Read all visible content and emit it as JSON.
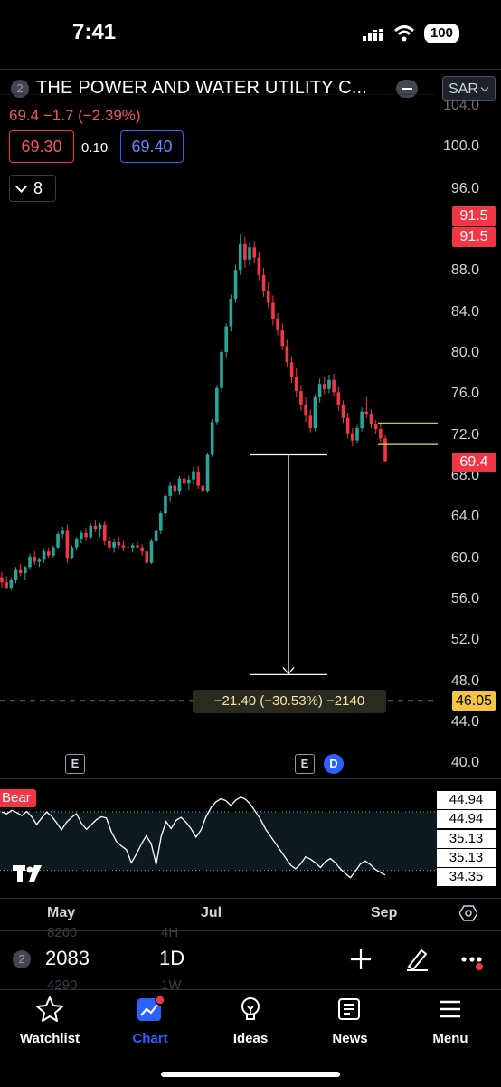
{
  "status": {
    "time": "7:41",
    "battery": "100"
  },
  "header": {
    "symbol_badge": "2",
    "title": "THE POWER AND WATER UTILITY C...",
    "currency": "SAR",
    "price_line": "69.4  −1.7 (−2.39%)",
    "bid": "69.30",
    "spread": "0.10",
    "ask": "69.40",
    "indicators_count": "8"
  },
  "price_axis": {
    "ticks": [
      "100.0",
      "96.0",
      "88.0",
      "84.0",
      "80.0",
      "76.0",
      "72.0",
      "68.0",
      "64.0",
      "60.0",
      "56.0",
      "52.0",
      "48.0",
      "44.0",
      "40.0"
    ],
    "partial_top": "104.0"
  },
  "price_tags": {
    "high_a": "91.5",
    "high_b": "91.5",
    "last": "69.4",
    "target": "46.05"
  },
  "measure_label": "−21.40 (−30.53%) −2140",
  "events": {
    "earnings_1": "E",
    "earnings_2": "E",
    "dividend": "D"
  },
  "oscillator": {
    "label": "Bear",
    "tags": [
      "44.94",
      "44.94",
      "35.13",
      "35.13",
      "34.35"
    ]
  },
  "time_axis": [
    "May",
    "Jul",
    "Sep"
  ],
  "bottom_toolbar": {
    "symbol_badge": "2",
    "symbol": "2083",
    "interval": "1D",
    "ghost_above_symbol": "8260",
    "ghost_below_symbol": "4290",
    "ghost_above_interval": "4H",
    "ghost_below_interval": "1W"
  },
  "tabs": [
    {
      "label": "Watchlist",
      "icon": "star-icon"
    },
    {
      "label": "Chart",
      "icon": "chart-icon",
      "active": true
    },
    {
      "label": "Ideas",
      "icon": "lightbulb-icon"
    },
    {
      "label": "News",
      "icon": "news-icon"
    },
    {
      "label": "Menu",
      "icon": "menu-icon"
    }
  ],
  "colors": {
    "up": "#26a69a",
    "down": "#f23645",
    "accent": "#2962ff",
    "target": "#f5c542"
  },
  "chart_data": {
    "type": "candlestick",
    "x_labels": [
      "May",
      "Jul",
      "Sep"
    ],
    "ylim": [
      40,
      104
    ],
    "candles": [
      [
        58.0,
        58.6,
        57.0,
        57.6
      ],
      [
        57.6,
        58.2,
        56.9,
        57.0
      ],
      [
        57.0,
        58.0,
        56.8,
        57.8
      ],
      [
        57.8,
        59.0,
        57.5,
        58.8
      ],
      [
        58.8,
        59.4,
        58.2,
        58.5
      ],
      [
        58.5,
        59.2,
        57.8,
        59.0
      ],
      [
        59.0,
        60.4,
        58.8,
        60.1
      ],
      [
        60.1,
        60.6,
        59.3,
        59.6
      ],
      [
        59.6,
        60.0,
        59.0,
        59.8
      ],
      [
        59.8,
        60.8,
        59.5,
        60.6
      ],
      [
        60.6,
        61.0,
        59.9,
        60.2
      ],
      [
        60.2,
        61.2,
        60.0,
        61.0
      ],
      [
        61.0,
        62.5,
        60.8,
        62.3
      ],
      [
        62.3,
        63.0,
        61.9,
        62.6
      ],
      [
        62.6,
        63.2,
        59.5,
        60.0
      ],
      [
        60.0,
        61.2,
        59.8,
        61.0
      ],
      [
        61.0,
        62.0,
        60.7,
        61.8
      ],
      [
        61.8,
        62.6,
        61.4,
        62.4
      ],
      [
        62.4,
        62.9,
        61.6,
        62.0
      ],
      [
        62.0,
        63.3,
        61.8,
        63.1
      ],
      [
        63.1,
        63.6,
        62.5,
        62.8
      ],
      [
        62.8,
        63.4,
        62.0,
        63.2
      ],
      [
        63.2,
        63.5,
        61.2,
        61.6
      ],
      [
        61.6,
        62.0,
        60.7,
        61.0
      ],
      [
        61.0,
        61.8,
        60.5,
        61.5
      ],
      [
        61.5,
        62.0,
        60.8,
        61.2
      ],
      [
        61.2,
        61.6,
        60.6,
        61.0
      ],
      [
        61.0,
        61.5,
        60.4,
        60.9
      ],
      [
        60.9,
        61.4,
        60.5,
        61.2
      ],
      [
        61.2,
        61.6,
        60.8,
        61.0
      ],
      [
        61.0,
        61.3,
        60.2,
        60.6
      ],
      [
        60.6,
        61.0,
        59.2,
        59.5
      ],
      [
        59.5,
        61.8,
        59.4,
        61.6
      ],
      [
        61.6,
        62.9,
        61.4,
        62.6
      ],
      [
        62.6,
        64.5,
        62.3,
        64.3
      ],
      [
        64.3,
        66.2,
        64.0,
        66.0
      ],
      [
        66.0,
        67.4,
        65.4,
        67.0
      ],
      [
        67.0,
        67.8,
        66.0,
        66.4
      ],
      [
        66.4,
        67.9,
        66.1,
        67.7
      ],
      [
        67.7,
        68.5,
        66.8,
        67.2
      ],
      [
        67.2,
        68.0,
        66.6,
        67.6
      ],
      [
        67.6,
        68.8,
        67.1,
        68.4
      ],
      [
        68.4,
        68.9,
        66.7,
        67.0
      ],
      [
        67.0,
        67.5,
        66.0,
        66.5
      ],
      [
        66.5,
        70.2,
        66.3,
        70.0
      ],
      [
        70.0,
        73.5,
        69.8,
        73.2
      ],
      [
        73.2,
        76.8,
        72.9,
        76.5
      ],
      [
        76.5,
        80.2,
        76.2,
        80.0
      ],
      [
        80.0,
        82.8,
        79.5,
        82.5
      ],
      [
        82.5,
        85.6,
        82.0,
        85.2
      ],
      [
        85.2,
        88.5,
        84.8,
        88.0
      ],
      [
        88.0,
        91.5,
        87.5,
        90.5
      ],
      [
        90.5,
        91.2,
        88.2,
        89.0
      ],
      [
        89.0,
        90.6,
        88.4,
        90.2
      ],
      [
        90.2,
        90.8,
        88.6,
        89.2
      ],
      [
        89.2,
        89.8,
        87.0,
        87.5
      ],
      [
        87.5,
        88.2,
        85.4,
        86.0
      ],
      [
        86.0,
        86.8,
        84.3,
        84.8
      ],
      [
        84.8,
        85.5,
        82.6,
        83.2
      ],
      [
        83.2,
        83.8,
        81.6,
        82.1
      ],
      [
        82.1,
        82.8,
        80.2,
        80.6
      ],
      [
        80.6,
        81.2,
        78.5,
        79.0
      ],
      [
        79.0,
        79.6,
        77.0,
        77.6
      ],
      [
        77.6,
        78.4,
        75.6,
        76.2
      ],
      [
        76.2,
        76.8,
        74.3,
        74.9
      ],
      [
        74.9,
        75.6,
        73.2,
        73.8
      ],
      [
        73.8,
        74.4,
        72.2,
        72.6
      ],
      [
        72.6,
        75.9,
        72.3,
        75.6
      ],
      [
        75.6,
        77.4,
        75.1,
        76.9
      ],
      [
        76.9,
        77.6,
        75.9,
        76.4
      ],
      [
        76.4,
        77.8,
        76.0,
        77.3
      ],
      [
        77.3,
        77.9,
        75.7,
        76.1
      ],
      [
        76.1,
        76.6,
        74.3,
        74.8
      ],
      [
        74.8,
        75.3,
        73.1,
        73.6
      ],
      [
        73.6,
        74.1,
        71.6,
        72.1
      ],
      [
        72.1,
        72.6,
        70.8,
        71.4
      ],
      [
        71.4,
        72.9,
        71.1,
        72.6
      ],
      [
        72.6,
        74.6,
        72.3,
        74.2
      ],
      [
        74.2,
        75.6,
        73.6,
        74.0
      ],
      [
        74.0,
        74.4,
        72.6,
        73.0
      ],
      [
        73.0,
        73.4,
        72.0,
        72.5
      ],
      [
        72.5,
        73.0,
        71.2,
        71.6
      ],
      [
        71.6,
        71.9,
        69.3,
        69.4
      ]
    ],
    "oscillator_values": [
      44.9,
      44.6,
      45.2,
      44.8,
      44.3,
      45.0,
      44.1,
      42.8,
      43.9,
      44.9,
      44.2,
      43.1,
      41.9,
      43.2,
      44.0,
      44.6,
      43.0,
      42.0,
      42.8,
      43.6,
      44.1,
      43.9,
      41.6,
      40.0,
      39.2,
      38.6,
      36.4,
      37.8,
      39.5,
      40.9,
      39.6,
      36.1,
      40.8,
      43.3,
      42.1,
      43.5,
      44.0,
      43.2,
      42.1,
      40.7,
      41.9,
      44.1,
      45.6,
      46.6,
      47.1,
      46.8,
      46.0,
      46.9,
      47.4,
      47.0,
      46.1,
      44.9,
      43.6,
      42.0,
      40.8,
      39.6,
      38.4,
      37.2,
      36.0,
      35.4,
      36.2,
      37.4,
      37.0,
      36.4,
      35.6,
      36.6,
      37.1,
      36.4,
      35.4,
      34.6,
      33.9,
      35.0,
      36.2,
      36.7,
      36.1,
      35.3,
      34.8,
      34.35
    ],
    "drawings": {
      "high_level": 91.5,
      "target_level": 46.05,
      "measure_from": 70.0,
      "measure_to": 48.6,
      "resistance_levels": [
        73.1,
        71.0
      ]
    }
  }
}
